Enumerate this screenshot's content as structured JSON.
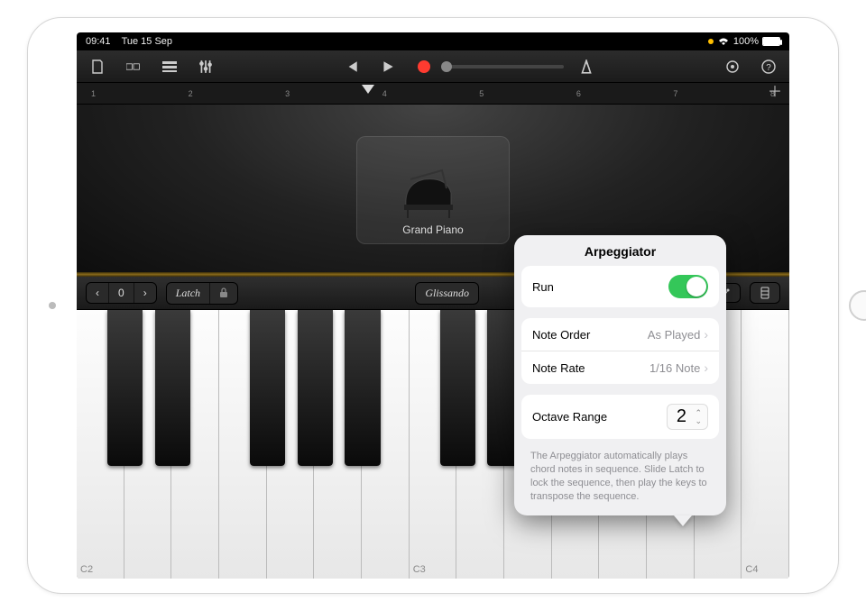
{
  "status": {
    "time": "09:41",
    "date": "Tue 15 Sep",
    "battery_pct": "100%"
  },
  "ruler": {
    "ticks": [
      "1",
      "2",
      "3",
      "4",
      "5",
      "6",
      "7",
      "8"
    ]
  },
  "instrument": {
    "name": "Grand Piano"
  },
  "controls": {
    "octave_value": "0",
    "latch_label": "Latch",
    "glissando_label": "Glissando"
  },
  "keyboard": {
    "labels": {
      "c2": "C2",
      "c3": "C3",
      "c4": "C4"
    }
  },
  "popover": {
    "title": "Arpeggiator",
    "run_label": "Run",
    "note_order_label": "Note Order",
    "note_order_value": "As Played",
    "note_rate_label": "Note Rate",
    "note_rate_value": "1/16 Note",
    "octave_range_label": "Octave Range",
    "octave_range_value": "2",
    "help": "The Arpeggiator automatically plays chord notes in sequence. Slide Latch to lock the sequence, then play the keys to transpose the sequence."
  }
}
